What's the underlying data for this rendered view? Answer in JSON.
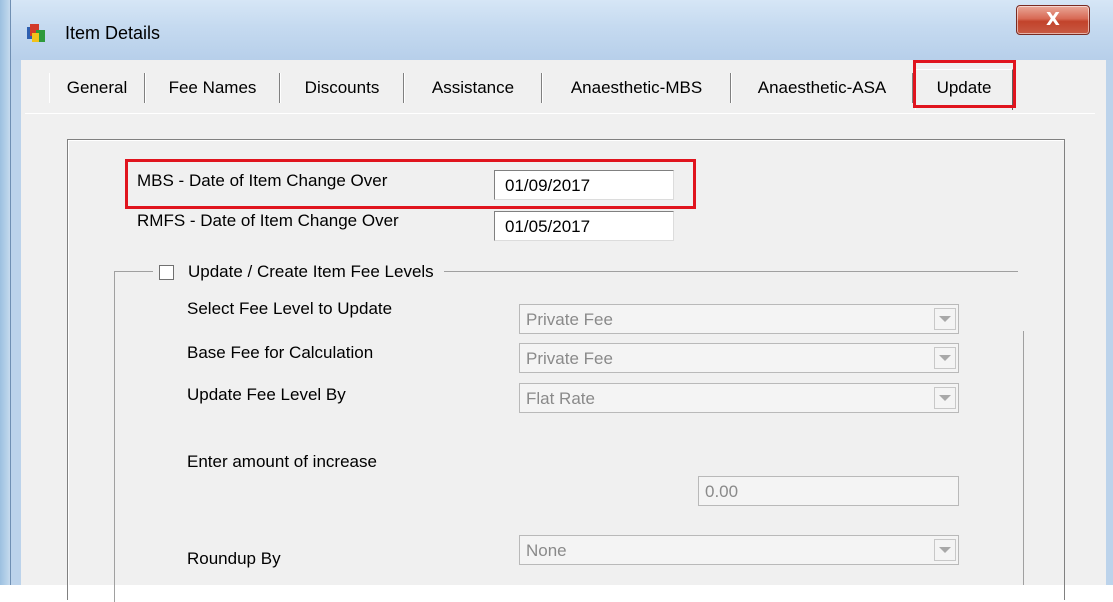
{
  "window": {
    "title": "Item Details",
    "close_glyph": "X",
    "app_icon": "item-details-app-icon"
  },
  "tabs": [
    {
      "label": "General"
    },
    {
      "label": "Fee Names"
    },
    {
      "label": "Discounts"
    },
    {
      "label": "Assistance"
    },
    {
      "label": "Anaesthetic-MBS"
    },
    {
      "label": "Anaesthetic-ASA"
    },
    {
      "label": "Update"
    }
  ],
  "active_tab": "Update",
  "update": {
    "mbs_label": "MBS - Date of Item Change Over",
    "mbs_value": "01/09/2017",
    "rmfs_label": "RMFS - Date of Item Change Over",
    "rmfs_value": "01/05/2017",
    "group_label": "Update / Create Item Fee Levels",
    "group_checked": false,
    "select_fee_label": "Select Fee Level to Update",
    "select_fee_value": "Private Fee",
    "base_fee_label": "Base Fee for Calculation",
    "base_fee_value": "Private Fee",
    "update_by_label": "Update Fee Level By",
    "update_by_value": "Flat Rate",
    "amount_label": "Enter amount of increase",
    "amount_value": "0.00",
    "roundup_label": "Roundup By",
    "roundup_value": "None"
  },
  "colors": {
    "highlight": "#e0141e",
    "close_button": "#c2432b"
  }
}
